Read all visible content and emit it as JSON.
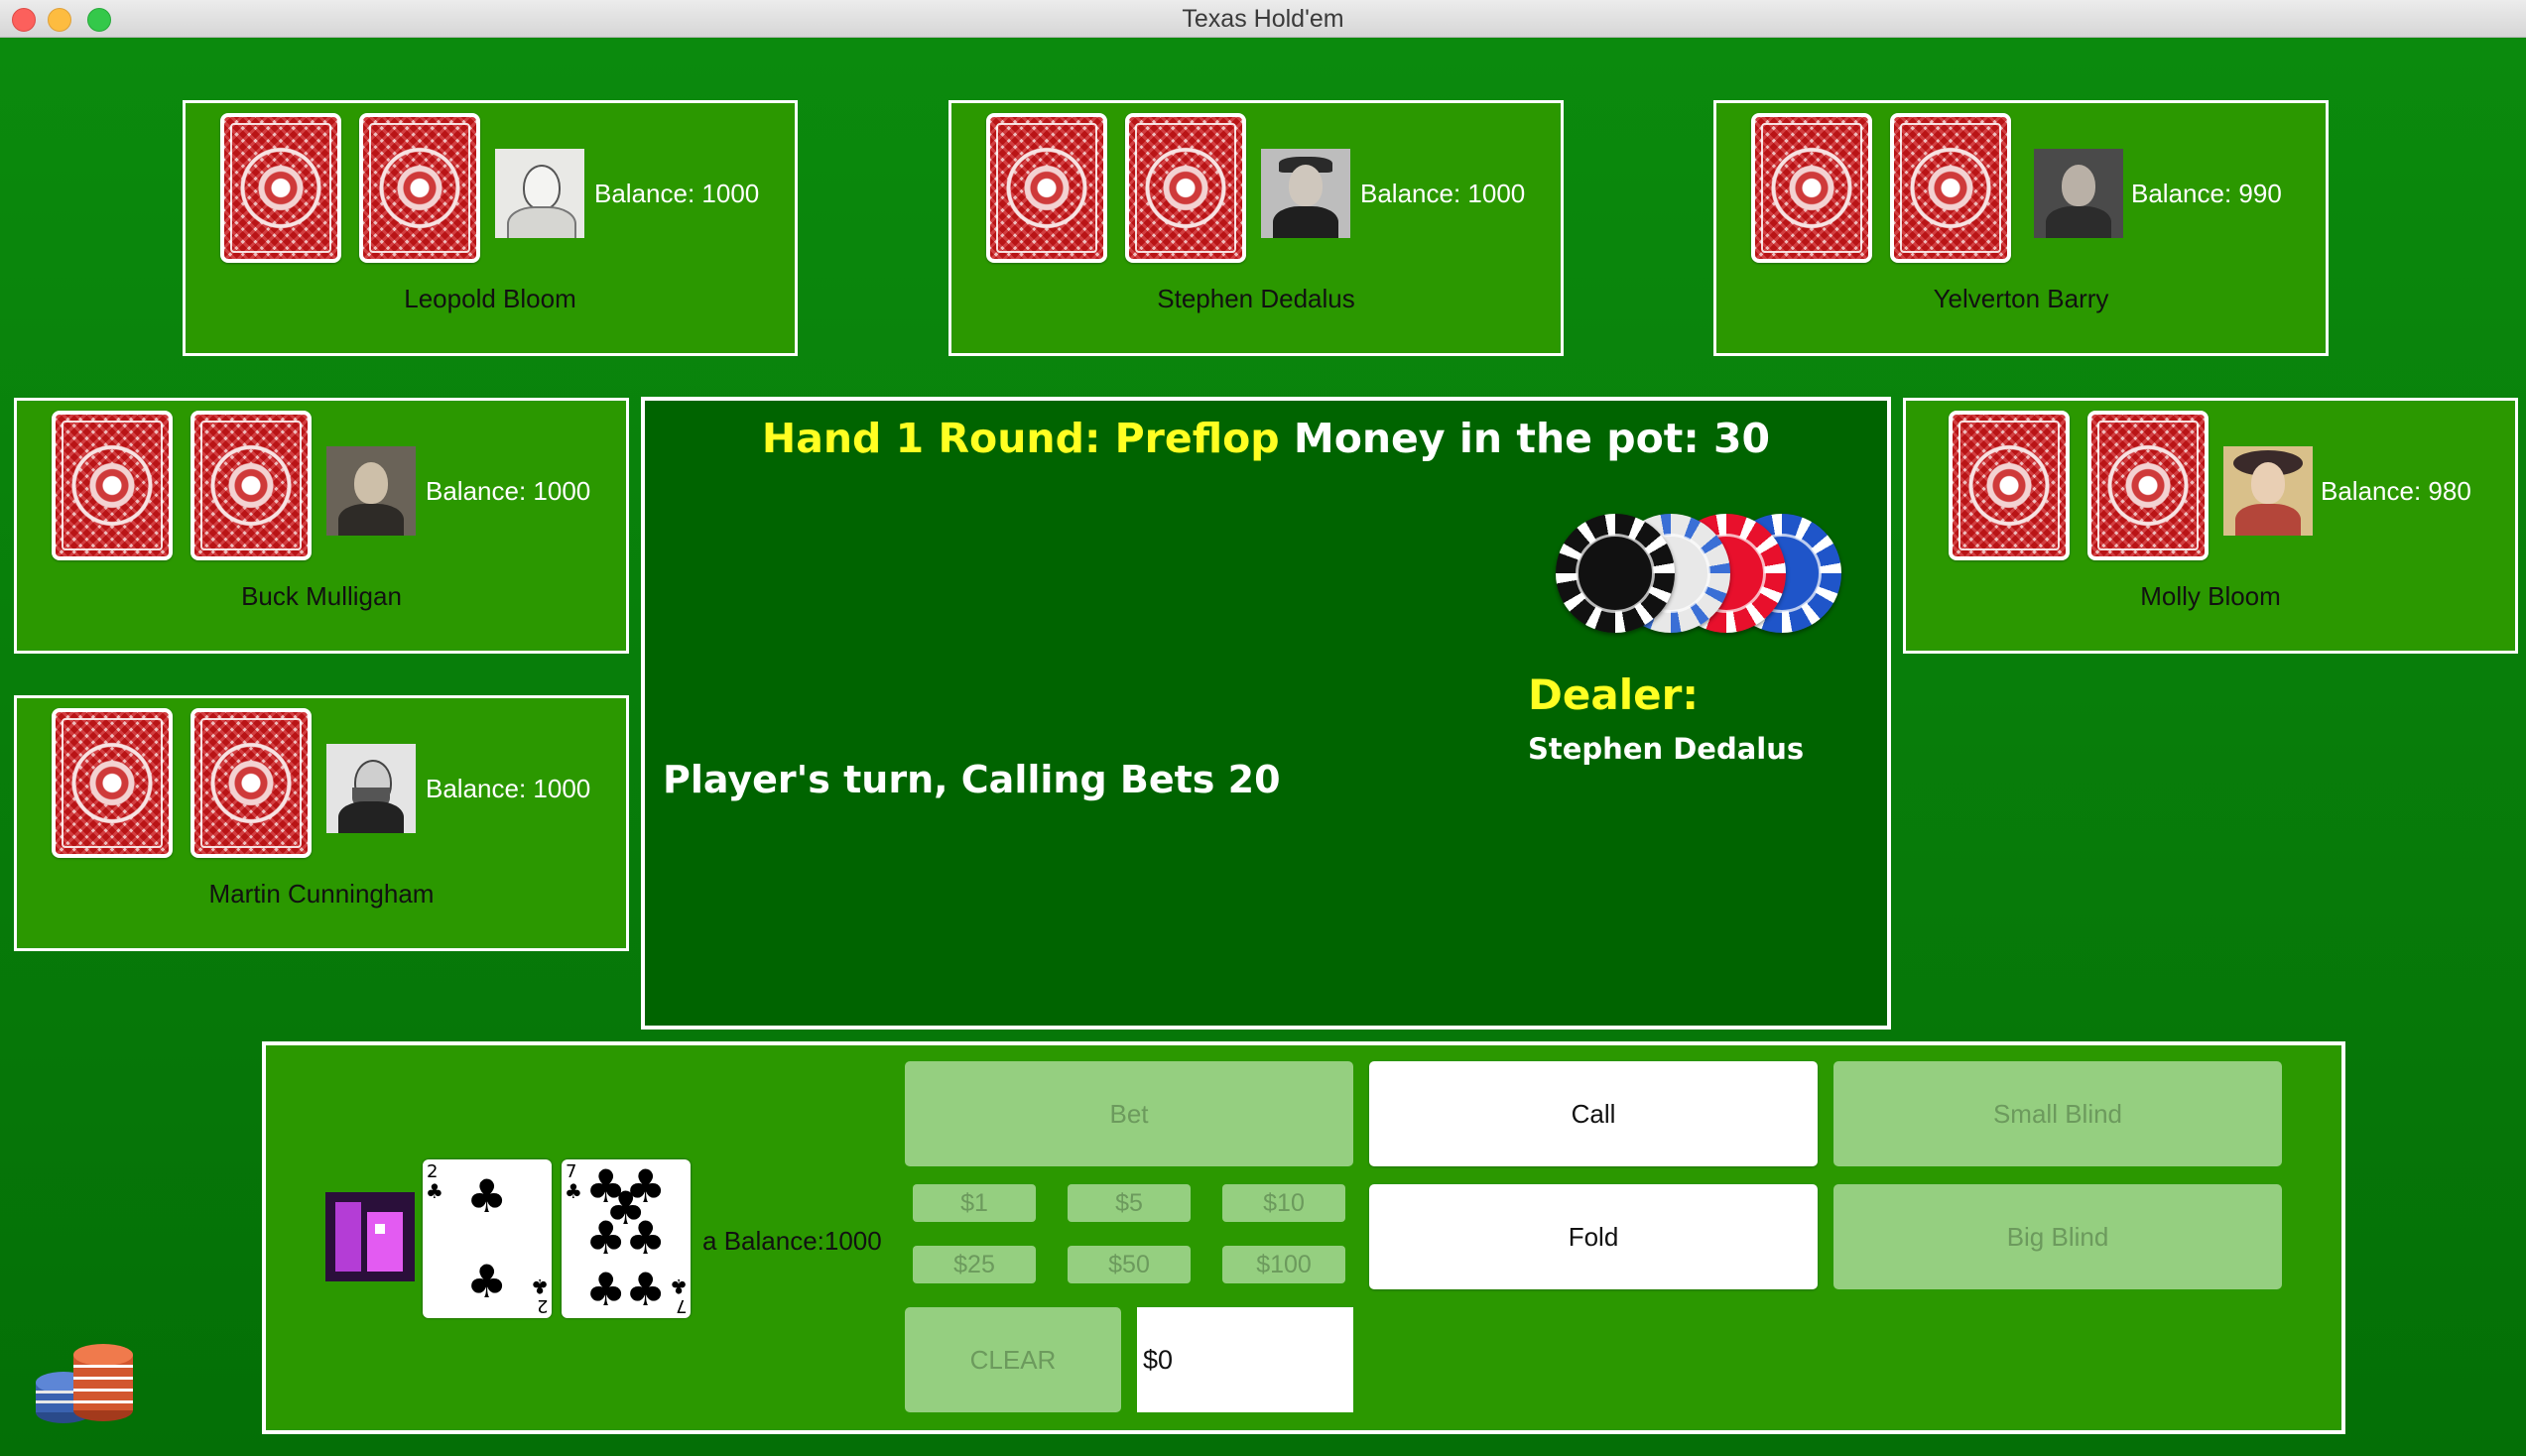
{
  "window": {
    "title": "Texas Hold'em"
  },
  "opponents": [
    {
      "name": "Leopold Bloom",
      "balance": "Balance: 1000",
      "avatar": "sketch-portrait"
    },
    {
      "name": "Stephen Dedalus",
      "balance": "Balance: 1000",
      "avatar": "man-with-hat-portrait"
    },
    {
      "name": "Yelverton Barry",
      "balance": "Balance: 990",
      "avatar": "woman-portrait"
    },
    {
      "name": "Buck Mulligan",
      "balance": "Balance: 1000",
      "avatar": "man-portrait"
    },
    {
      "name": "Molly Bloom",
      "balance": "Balance: 980",
      "avatar": "woman-with-hat-portrait"
    },
    {
      "name": "Martin Cunningham",
      "balance": "Balance: 1000",
      "avatar": "bearded-man-portrait"
    }
  ],
  "center": {
    "hand_round": "Hand 1 Round: Preflop",
    "pot": "Money in the pot: 30",
    "status": "Player's turn, Calling Bets 20",
    "dealer_label": "Dealer:",
    "dealer_name": "Stephen Dedalus",
    "chip_colors": [
      "#111111",
      "#e8e8e8",
      "#e8102c",
      "#1f55c9"
    ]
  },
  "user": {
    "name": "a",
    "balance": "Balance:1000",
    "cards": [
      {
        "rank": "2",
        "suit": "♣"
      },
      {
        "rank": "7",
        "suit": "♣"
      }
    ]
  },
  "controls": {
    "bet": "Bet",
    "call": "Call",
    "small_blind": "Small Blind",
    "fold": "Fold",
    "big_blind": "Big Blind",
    "clear": "CLEAR",
    "amount": "$0",
    "chips": [
      "$1",
      "$5",
      "$10",
      "$25",
      "$50",
      "$100"
    ]
  }
}
